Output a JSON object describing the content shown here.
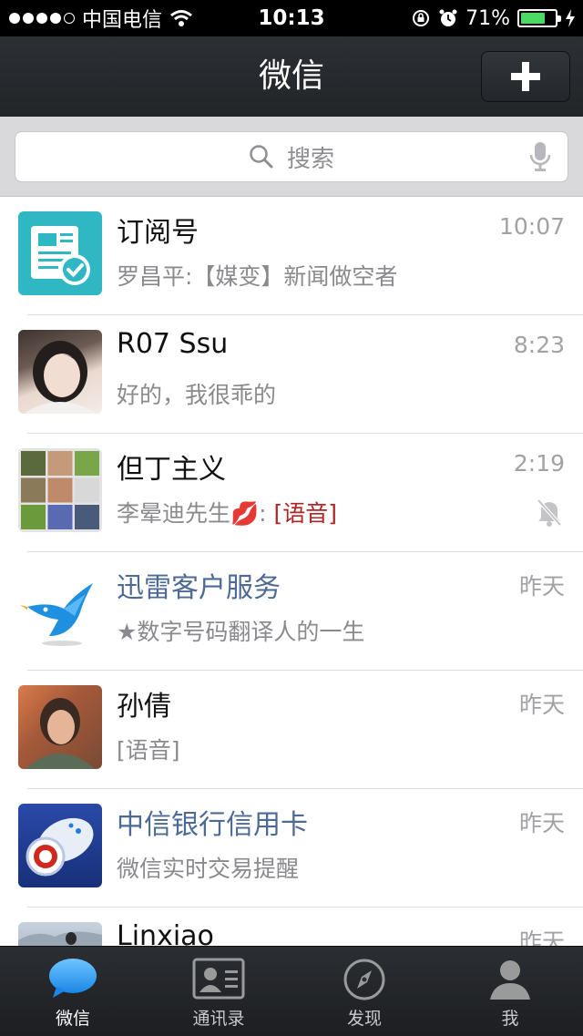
{
  "status_bar": {
    "carrier": "中国电信",
    "time": "10:13",
    "battery_percent": "71%",
    "battery_level": 0.71,
    "signal_bars": 4
  },
  "nav": {
    "title": "微信",
    "add_icon": "plus-icon"
  },
  "search": {
    "placeholder": "搜索"
  },
  "chats": [
    {
      "name": "订阅号",
      "time": "10:07",
      "preview": "罗昌平:【媒变】新闻做空者",
      "avatar": "subscription-icon"
    },
    {
      "name": "R07 Ssu",
      "time": "8:23",
      "preview": "好的，我很乖的",
      "avatar": "user-photo"
    },
    {
      "name": "但丁主义",
      "time": "2:19",
      "preview_prefix": "李晕迪先生💋: ",
      "preview_tag": "[语音]",
      "muted": true,
      "avatar": "group-grid"
    },
    {
      "name": "迅雷客户服务",
      "time": "昨天",
      "preview": "★数字号码翻译人的一生",
      "official": true,
      "avatar": "bird-logo"
    },
    {
      "name": "孙倩",
      "time": "昨天",
      "preview": "[语音]",
      "avatar": "user-photo"
    },
    {
      "name": "中信银行信用卡",
      "time": "昨天",
      "preview": "微信实时交易提醒",
      "official": true,
      "avatar": "bank-logo"
    },
    {
      "name": "Linxiao",
      "time": "昨天",
      "avatar": "user-photo"
    }
  ],
  "tabs": [
    {
      "label": "微信",
      "icon": "chat-bubble-icon",
      "active": true
    },
    {
      "label": "通讯录",
      "icon": "contacts-card-icon"
    },
    {
      "label": "发现",
      "icon": "compass-icon"
    },
    {
      "label": "我",
      "icon": "person-icon"
    }
  ],
  "colors": {
    "navbar": "#2c2f33",
    "official_name": "#4d6a96",
    "voice_tag": "#b32424",
    "battery": "#4cd964",
    "subscription_tile": "#2fb7c4"
  }
}
